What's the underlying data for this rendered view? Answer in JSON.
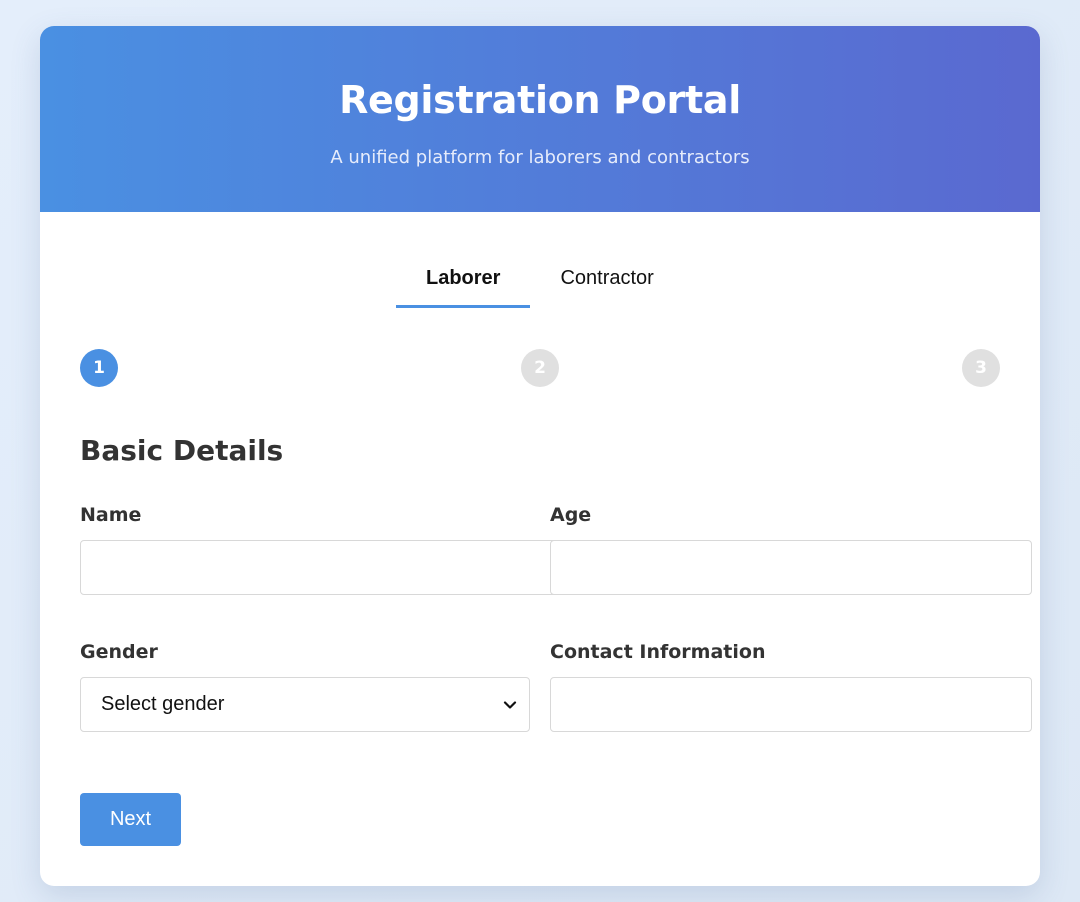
{
  "header": {
    "title": "Registration Portal",
    "subtitle": "A unified platform for laborers and contractors"
  },
  "tabs": [
    {
      "label": "Laborer",
      "active": true
    },
    {
      "label": "Contractor",
      "active": false
    }
  ],
  "stepper": {
    "steps": [
      "1",
      "2",
      "3"
    ],
    "current_step": 1
  },
  "form": {
    "section_title": "Basic Details",
    "name": {
      "label": "Name",
      "value": ""
    },
    "age": {
      "label": "Age",
      "value": ""
    },
    "gender": {
      "label": "Gender",
      "selected": "Select gender"
    },
    "contact": {
      "label": "Contact Information",
      "value": ""
    },
    "next_label": "Next"
  },
  "colors": {
    "accent": "#4a90e2",
    "header_gradient_start": "#4a90e2",
    "header_gradient_end": "#5a69d0",
    "step_inactive": "#e0e0e0"
  }
}
